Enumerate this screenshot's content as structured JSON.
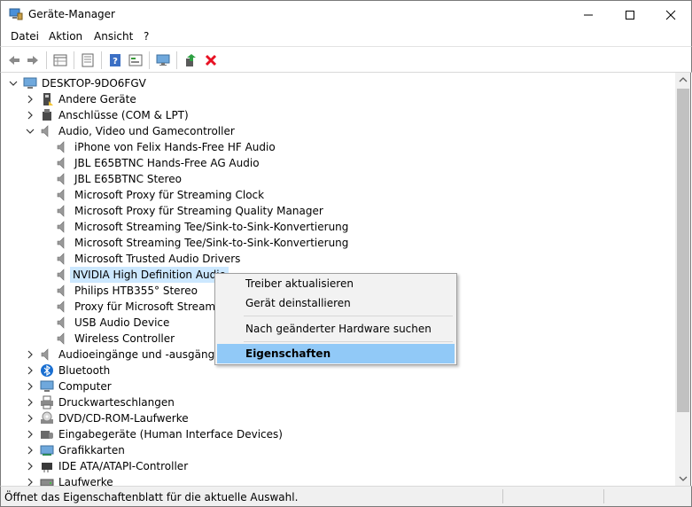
{
  "window": {
    "title": "Geräte-Manager"
  },
  "menu": [
    "Datei",
    "Aktion",
    "Ansicht",
    "?"
  ],
  "toolbar": {
    "icons": [
      "back-icon",
      "forward-icon",
      "properties-grid-icon",
      "details-icon",
      "help-icon",
      "view-icon",
      "monitor-icon",
      "update-driver-icon",
      "uninstall-icon"
    ],
    "uninstall_color": "#e81123"
  },
  "tree": {
    "root": "DESKTOP-9DO6FGV",
    "rows": [
      {
        "label": "Andere Geräte",
        "level": 1,
        "expander": "collapsed",
        "icon": "unknown-device-icon"
      },
      {
        "label": "Anschlüsse (COM & LPT)",
        "level": 1,
        "expander": "collapsed",
        "icon": "port-icon"
      },
      {
        "label": "Audio, Video und Gamecontroller",
        "level": 1,
        "expander": "expanded",
        "icon": "speaker-icon"
      },
      {
        "label": "iPhone von Felix Hands-Free HF Audio",
        "level": 2,
        "icon": "speaker-icon"
      },
      {
        "label": "JBL E65BTNC Hands-Free AG Audio",
        "level": 2,
        "icon": "speaker-icon"
      },
      {
        "label": "JBL E65BTNC Stereo",
        "level": 2,
        "icon": "speaker-icon"
      },
      {
        "label": "Microsoft Proxy für Streaming Clock",
        "level": 2,
        "icon": "speaker-icon"
      },
      {
        "label": "Microsoft Proxy für Streaming Quality Manager",
        "level": 2,
        "icon": "speaker-icon"
      },
      {
        "label": "Microsoft Streaming Tee/Sink-to-Sink-Konvertierung",
        "level": 2,
        "icon": "speaker-icon"
      },
      {
        "label": "Microsoft Streaming Tee/Sink-to-Sink-Konvertierung",
        "level": 2,
        "icon": "speaker-icon"
      },
      {
        "label": "Microsoft Trusted Audio Drivers",
        "level": 2,
        "icon": "speaker-icon"
      },
      {
        "label": "NVIDIA High Definition Audio",
        "level": 2,
        "icon": "speaker-icon",
        "selected": true
      },
      {
        "label": "Philips HTB355° Stereo",
        "level": 2,
        "icon": "speaker-icon"
      },
      {
        "label": "Proxy für Microsoft Streaming",
        "level": 2,
        "icon": "speaker-icon"
      },
      {
        "label": "USB Audio Device",
        "level": 2,
        "icon": "speaker-icon"
      },
      {
        "label": "Wireless Controller",
        "level": 2,
        "icon": "speaker-icon"
      },
      {
        "label": "Audioeingänge und -ausgänge",
        "level": 1,
        "expander": "collapsed",
        "icon": "speaker-icon"
      },
      {
        "label": "Bluetooth",
        "level": 1,
        "expander": "collapsed",
        "icon": "bluetooth-icon"
      },
      {
        "label": "Computer",
        "level": 1,
        "expander": "collapsed",
        "icon": "computer-icon"
      },
      {
        "label": "Druckwarteschlangen",
        "level": 1,
        "expander": "collapsed",
        "icon": "printer-icon"
      },
      {
        "label": "DVD/CD-ROM-Laufwerke",
        "level": 1,
        "expander": "collapsed",
        "icon": "disc-icon"
      },
      {
        "label": "Eingabegeräte (Human Interface Devices)",
        "level": 1,
        "expander": "collapsed",
        "icon": "hid-icon"
      },
      {
        "label": "Grafikkarten",
        "level": 1,
        "expander": "collapsed",
        "icon": "display-adapter-icon"
      },
      {
        "label": "IDE ATA/ATAPI-Controller",
        "level": 1,
        "expander": "collapsed",
        "icon": "ide-controller-icon"
      },
      {
        "label": "Laufwerke",
        "level": 1,
        "expander": "collapsed",
        "icon": "drive-icon"
      }
    ]
  },
  "context_menu": {
    "items": [
      {
        "label": "Treiber aktualisieren"
      },
      {
        "label": "Gerät deinstallieren"
      },
      {
        "separator": true
      },
      {
        "label": "Nach geänderter Hardware suchen"
      },
      {
        "separator": true
      },
      {
        "label": "Eigenschaften",
        "bold": true,
        "highlighted": true
      }
    ],
    "highlight_color": "#91c9f7"
  },
  "status": {
    "text": "Öffnet das Eigenschaftenblatt für die aktuelle Auswahl."
  },
  "colors": {
    "selection": "#cce8ff",
    "accent": "#0078d7"
  }
}
